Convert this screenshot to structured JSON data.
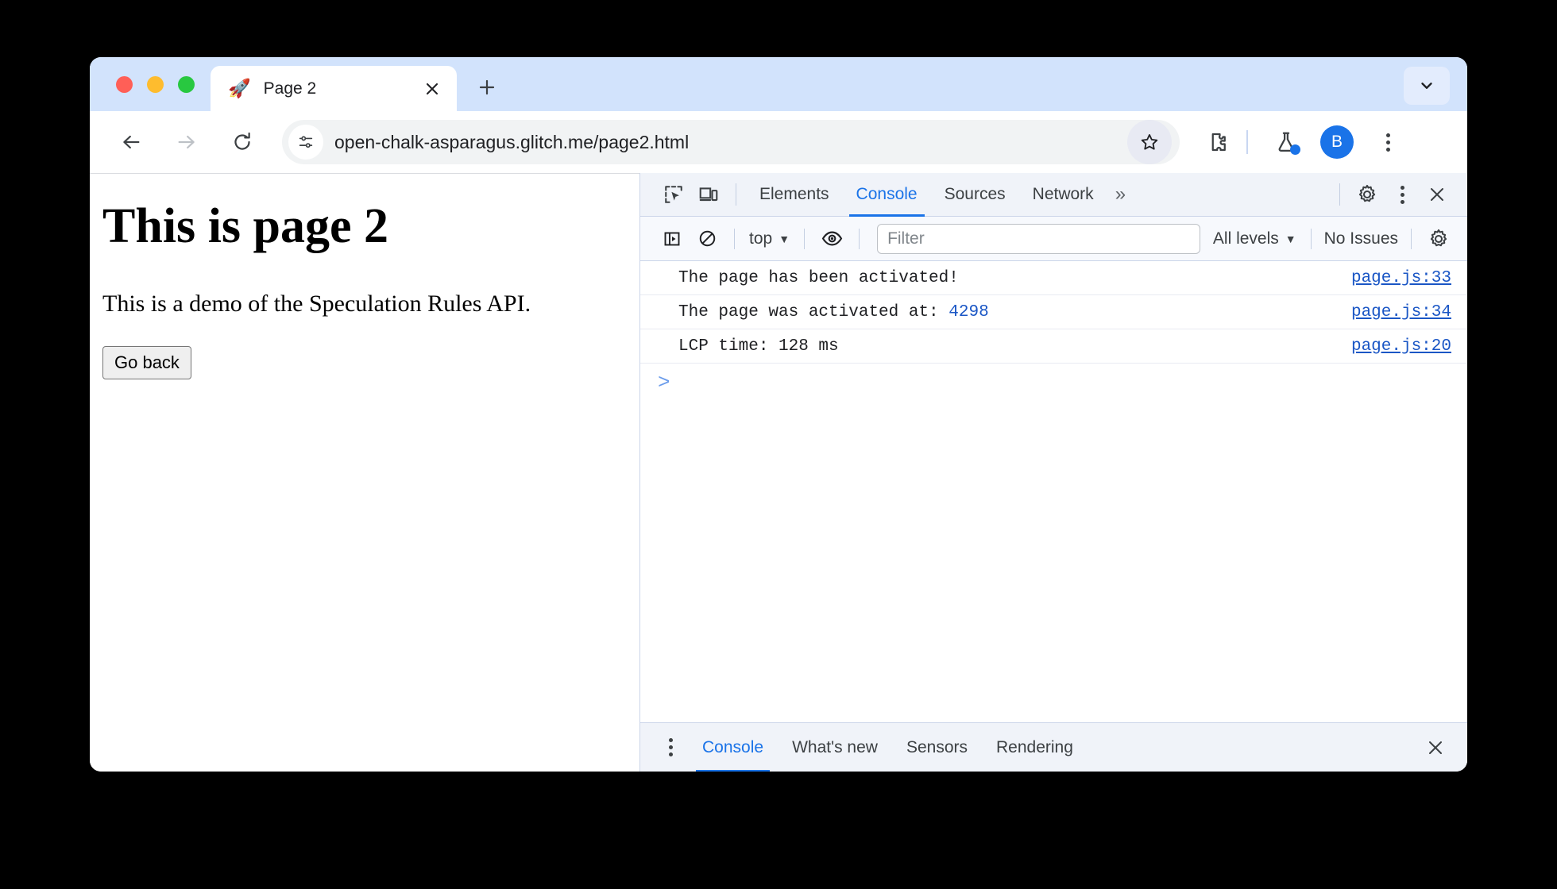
{
  "window": {
    "traffic_lights": [
      "close",
      "minimize",
      "maximize"
    ],
    "colors": {
      "red": "#ff5f57",
      "yellow": "#febc2e",
      "green": "#28c840",
      "tabstrip": "#d2e3fc",
      "accent": "#1a73e8"
    }
  },
  "tab": {
    "favicon": "rocket-icon",
    "favicon_glyph": "🚀",
    "title": "Page 2",
    "close_label": "✕",
    "new_tab_label": "+",
    "tab_list_label": "⌄"
  },
  "toolbar": {
    "back_label": "←",
    "forward_label": "→",
    "reload_label": "⟳",
    "url": "open-chalk-asparagus.glitch.me/page2.html",
    "site_info_icon": "tune-icon",
    "bookmark_icon": "star-icon",
    "extensions_icon": "puzzle-piece-icon",
    "labs_icon": "flask-icon",
    "avatar_letter": "B",
    "menu_icon": "kebab-menu-icon"
  },
  "page": {
    "heading": "This is page 2",
    "paragraph": "This is a demo of the Speculation Rules API.",
    "button_label": "Go back"
  },
  "devtools": {
    "inspect_icon": "inspect-element-icon",
    "device_icon": "device-toolbar-icon",
    "tabs": [
      {
        "label": "Elements",
        "active": false
      },
      {
        "label": "Console",
        "active": true
      },
      {
        "label": "Sources",
        "active": false
      },
      {
        "label": "Network",
        "active": false
      }
    ],
    "overflow_label": "»",
    "settings_icon": "gear-icon",
    "more_icon": "kebab-menu-icon",
    "close_icon": "close-icon",
    "console_toolbar": {
      "sidebar_icon": "console-sidebar-icon",
      "clear_icon": "clear-console-icon",
      "context_label": "top",
      "context_caret": "▼",
      "eye_icon": "live-expression-eye-icon",
      "filter_placeholder": "Filter",
      "filter_value": "",
      "levels_label": "All levels",
      "levels_caret": "▼",
      "issues_label": "No Issues",
      "settings_icon": "gear-icon"
    },
    "logs": [
      {
        "message": "The page has been activated!",
        "number": "",
        "source": "page.js:33"
      },
      {
        "message": "The page was activated at: ",
        "number": "4298",
        "source": "page.js:34"
      },
      {
        "message": "LCP time: 128 ms",
        "number": "",
        "source": "page.js:20"
      }
    ],
    "prompt": ">",
    "drawer": {
      "menu_icon": "kebab-menu-icon",
      "tabs": [
        {
          "label": "Console",
          "active": true
        },
        {
          "label": "What's new",
          "active": false
        },
        {
          "label": "Sensors",
          "active": false
        },
        {
          "label": "Rendering",
          "active": false
        }
      ],
      "close_icon": "close-icon"
    }
  }
}
